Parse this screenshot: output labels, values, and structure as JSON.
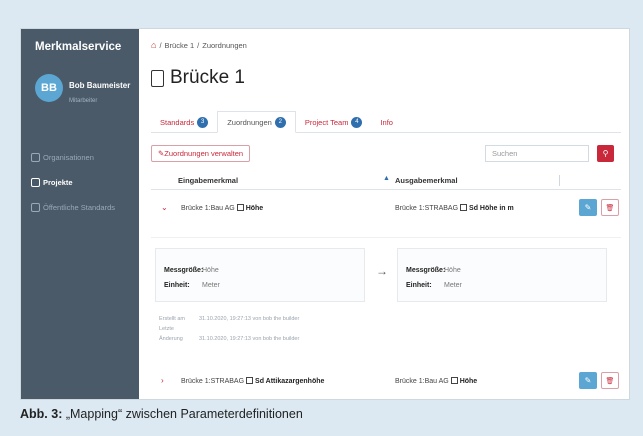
{
  "sidebar": {
    "brand": "Merkmalservice",
    "avatar_initials": "BB",
    "user_name": "Bob Baumeister",
    "user_role": "Mitarbeiter",
    "items": [
      {
        "label": "Organisationen",
        "active": false
      },
      {
        "label": "Projekte",
        "active": true
      },
      {
        "label": "Öffentliche Standards",
        "active": false
      }
    ]
  },
  "breadcrumb": {
    "item1": "Brücke 1",
    "sep": "/",
    "item2": "Zuordnungen"
  },
  "page_title": "Brücke 1",
  "tabs": [
    {
      "label": "Standards",
      "count": "3",
      "active": false
    },
    {
      "label": "Zuordnungen",
      "count": "2",
      "active": true
    },
    {
      "label": "Project Team",
      "count": "4",
      "active": false
    },
    {
      "label": "Info",
      "count": "",
      "active": false
    }
  ],
  "toolbar": {
    "manage_label": "Zuordnungen verwalten",
    "search_placeholder": "Suchen"
  },
  "table": {
    "col_input": "Eingabemerkmal",
    "col_output": "Ausgabemerkmal",
    "rows": [
      {
        "in_prefix": "Brücke 1:Bau AG",
        "in_name": "Höhe",
        "out_prefix": "Brücke 1:STRABAG",
        "out_name": "Sd Höhe in m"
      },
      {
        "in_prefix": "Brücke 1:STRABAG",
        "in_name": "Sd Attikazargenhöhe",
        "out_prefix": "Brücke 1:Bau AG",
        "out_name": "Höhe"
      }
    ]
  },
  "detail": {
    "left": {
      "k1": "Messgröße:",
      "v1": "Höhe",
      "k2": "Einheit:",
      "v2": "Meter"
    },
    "right": {
      "k1": "Messgröße:",
      "v1": "Höhe",
      "k2": "Einheit:",
      "v2": "Meter"
    },
    "created_label": "Erstellt am",
    "created_value": "31.10.2020, 19:27:13 von bob the builder",
    "changed_label": "Letzte Änderung",
    "changed_value": "31.10.2020, 19:27:13 von bob the builder"
  },
  "caption": {
    "label": "Abb. 3:",
    "text": "„Mapping“ zwischen Parameterdefinitionen"
  },
  "colors": {
    "sidebar": "#4a5a68",
    "accent_red": "#c8283a",
    "accent_blue": "#2f6fad",
    "edit_blue": "#5ba6d3",
    "page_bg": "#dce9f3"
  }
}
